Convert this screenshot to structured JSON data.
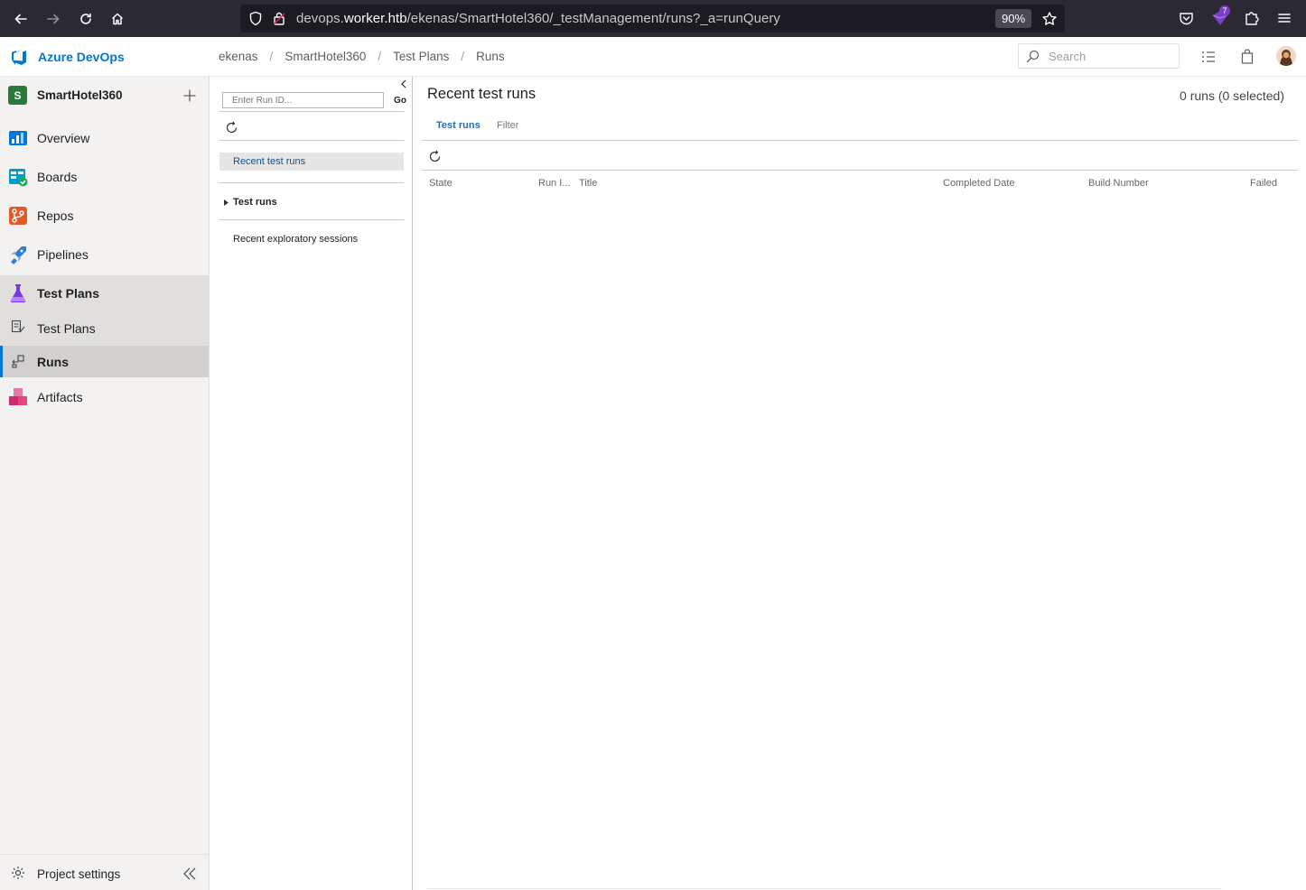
{
  "browser": {
    "url_prefix": "devops.",
    "url_host": "worker.htb",
    "url_path": "/ekenas/SmartHotel360/_testManagement/runs?_a=runQuery",
    "zoom": "90%",
    "extension_badge": "7"
  },
  "header": {
    "brand": "Azure DevOps",
    "breadcrumb": [
      "ekenas",
      "SmartHotel360",
      "Test Plans",
      "Runs"
    ],
    "search_placeholder": "Search"
  },
  "sidebar": {
    "project_initial": "S",
    "project_name": "SmartHotel360",
    "items": [
      {
        "label": "Overview"
      },
      {
        "label": "Boards"
      },
      {
        "label": "Repos"
      },
      {
        "label": "Pipelines"
      },
      {
        "label": "Test Plans"
      },
      {
        "label": "Test Plans"
      },
      {
        "label": "Runs"
      },
      {
        "label": "Artifacts"
      }
    ],
    "settings_label": "Project settings"
  },
  "left_pane": {
    "run_id_placeholder": "Enter Run ID...",
    "go_label": "Go",
    "recent_test_runs": "Recent test runs",
    "test_runs": "Test runs",
    "recent_exploratory": "Recent exploratory sessions"
  },
  "main": {
    "title": "Recent test runs",
    "run_count": "0 runs (0 selected)",
    "tabs": [
      "Test runs",
      "Filter"
    ],
    "columns": [
      "State",
      "Run I...",
      "Title",
      "Completed Date",
      "Build Number",
      "Failed"
    ]
  }
}
